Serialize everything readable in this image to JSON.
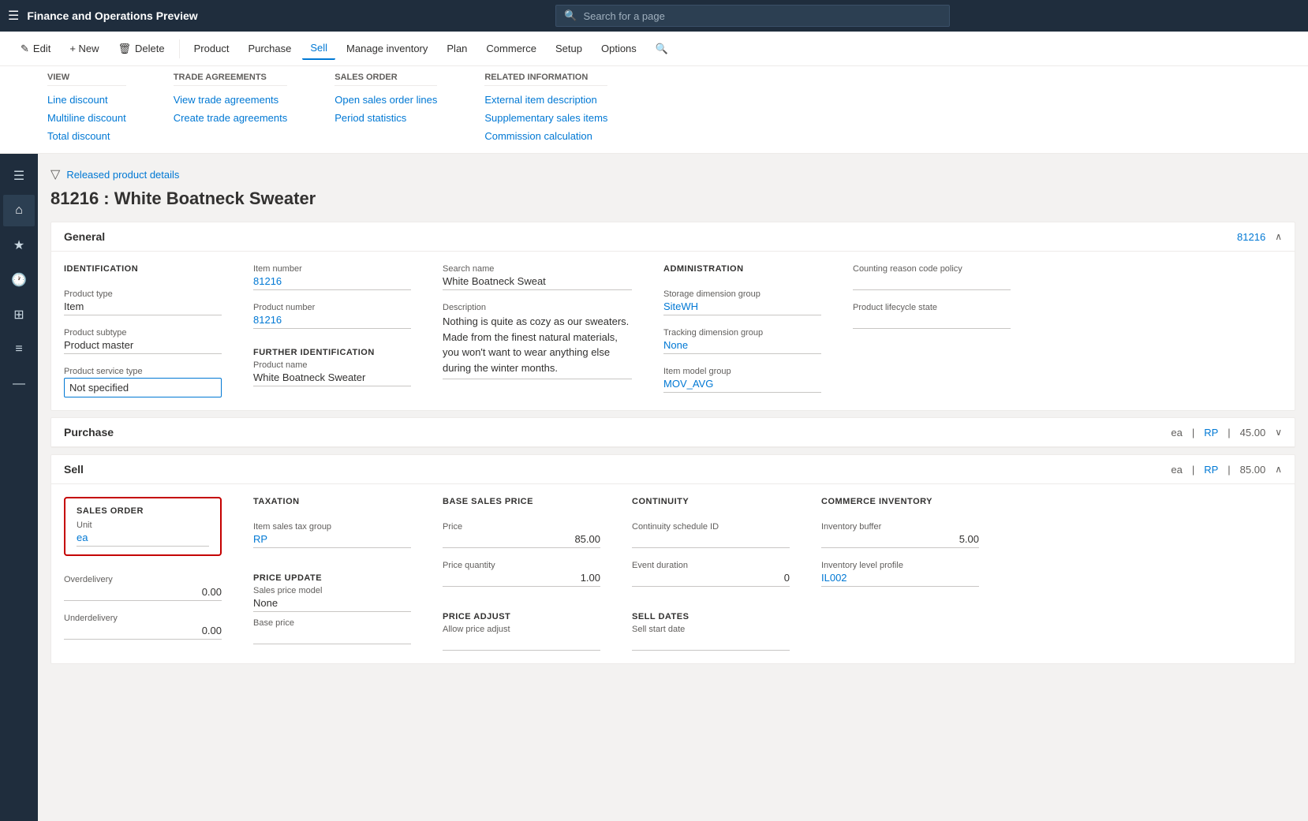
{
  "app": {
    "title": "Finance and Operations Preview",
    "search_placeholder": "Search for a page"
  },
  "command_bar": {
    "edit_label": "Edit",
    "new_label": "+ New",
    "delete_label": "Delete",
    "product_label": "Product",
    "purchase_label": "Purchase",
    "sell_label": "Sell",
    "manage_inventory_label": "Manage inventory",
    "plan_label": "Plan",
    "commerce_label": "Commerce",
    "setup_label": "Setup",
    "options_label": "Options"
  },
  "sell_menu": {
    "view_section": {
      "title": "View",
      "items": [
        "Line discount",
        "Multiline discount",
        "Total discount"
      ]
    },
    "trade_agreements_section": {
      "title": "Trade agreements",
      "items": [
        "View trade agreements",
        "Create trade agreements"
      ]
    },
    "sales_order_section": {
      "title": "Sales order",
      "items": [
        "Open sales order lines",
        "Period statistics"
      ]
    },
    "related_information_section": {
      "title": "Related information",
      "items": [
        "External item description",
        "Supplementary sales items",
        "Commission calculation"
      ]
    }
  },
  "breadcrumb": "Released product details",
  "page_title": "81216 : White Boatneck Sweater",
  "general_section": {
    "title": "General",
    "section_id": "81216",
    "identification": {
      "title": "IDENTIFICATION",
      "product_type_label": "Product type",
      "product_type_value": "Item",
      "product_subtype_label": "Product subtype",
      "product_subtype_value": "Product master",
      "product_service_type_label": "Product service type",
      "product_service_type_value": "Not specified"
    },
    "item_number": {
      "label": "Item number",
      "value": "81216"
    },
    "product_number": {
      "label": "Product number",
      "value": "81216"
    },
    "further_identification": {
      "title": "FURTHER IDENTIFICATION",
      "product_name_label": "Product name",
      "product_name_value": "White Boatneck Sweater"
    },
    "search_name": {
      "label": "Search name",
      "value": "White Boatneck Sweat"
    },
    "description": {
      "label": "Description",
      "value": "Nothing is quite as cozy as our sweaters. Made from the finest natural materials, you won't want to wear anything else during the winter months."
    },
    "administration": {
      "title": "ADMINISTRATION",
      "storage_dimension_group_label": "Storage dimension group",
      "storage_dimension_group_value": "SiteWH",
      "tracking_dimension_group_label": "Tracking dimension group",
      "tracking_dimension_group_value": "None",
      "item_model_group_label": "Item model group",
      "item_model_group_value": "MOV_AVG"
    },
    "counting_reason_code_policy_label": "Counting reason code policy",
    "counting_reason_code_policy_value": "",
    "product_lifecycle_state_label": "Product lifecycle state",
    "product_lifecycle_state_value": ""
  },
  "purchase_section": {
    "title": "Purchase",
    "summary": "ea",
    "rp": "RP",
    "price": "45.00"
  },
  "sell_section": {
    "title": "Sell",
    "summary": "ea",
    "rp": "RP",
    "price": "85.00",
    "sales_order": {
      "title": "SALES ORDER",
      "unit_label": "Unit",
      "unit_value": "ea",
      "overdelivery_label": "Overdelivery",
      "overdelivery_value": "0.00",
      "underdelivery_label": "Underdelivery",
      "underdelivery_value": "0.00"
    },
    "taxation": {
      "title": "TAXATION",
      "item_sales_tax_group_label": "Item sales tax group",
      "item_sales_tax_group_value": "RP"
    },
    "price_update": {
      "title": "PRICE UPDATE",
      "sales_price_model_label": "Sales price model",
      "sales_price_model_value": "None",
      "base_price_label": "Base price",
      "base_price_value": ""
    },
    "base_sales_price": {
      "title": "BASE SALES PRICE",
      "price_label": "Price",
      "price_value": "85.00",
      "price_quantity_label": "Price quantity",
      "price_quantity_value": "1.00"
    },
    "price_adjust": {
      "title": "PRICE ADJUST",
      "allow_price_adjust_label": "Allow price adjust"
    },
    "continuity": {
      "title": "CONTINUITY",
      "continuity_schedule_id_label": "Continuity schedule ID",
      "continuity_schedule_id_value": "",
      "event_duration_label": "Event duration",
      "event_duration_value": "0"
    },
    "sell_dates": {
      "title": "SELL DATES",
      "sell_start_date_label": "Sell start date"
    },
    "commerce_inventory": {
      "title": "COMMERCE INVENTORY",
      "inventory_buffer_label": "Inventory buffer",
      "inventory_buffer_value": "5.00",
      "inventory_level_profile_label": "Inventory level profile",
      "inventory_level_profile_value": "IL002"
    }
  },
  "sidebar": {
    "icons": [
      "☰",
      "⌂",
      "★",
      "🕐",
      "⊞",
      "≡",
      "—"
    ]
  }
}
